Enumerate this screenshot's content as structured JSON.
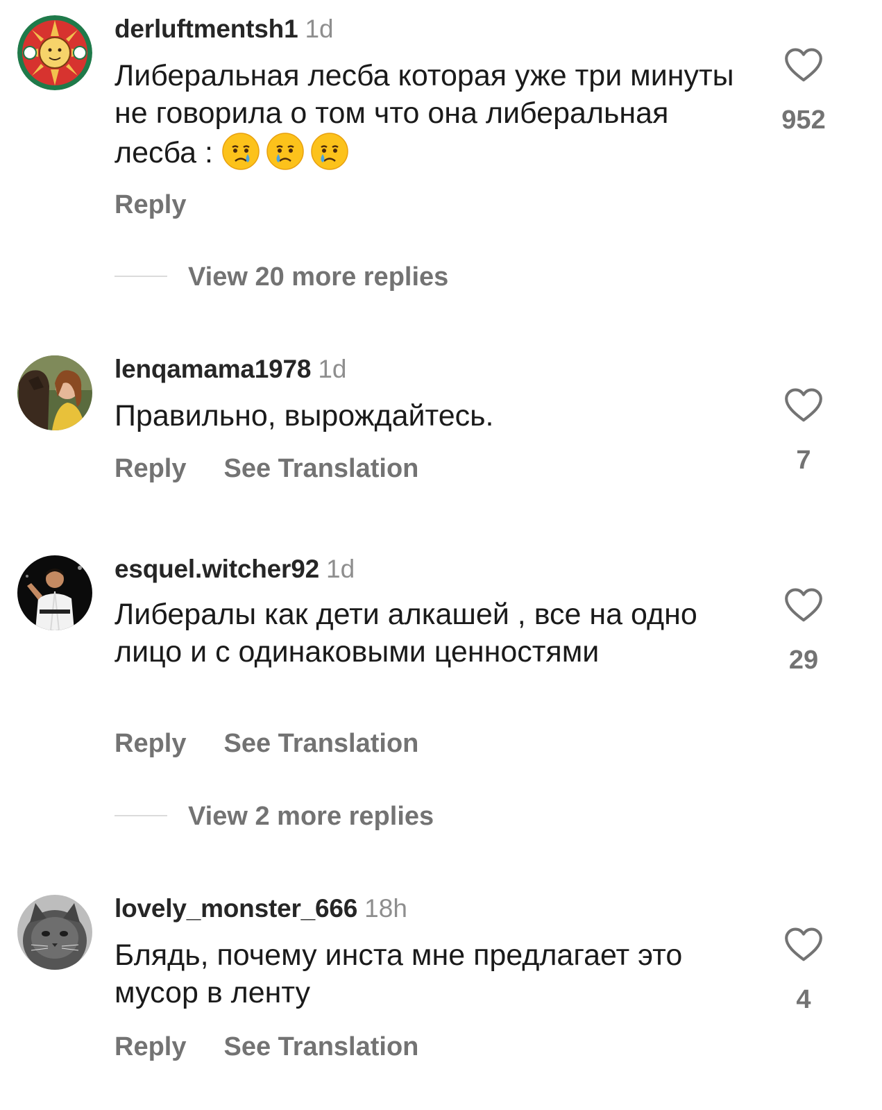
{
  "comments": [
    {
      "username": "derluftmentsh1",
      "time": "1d",
      "text": "Либеральная лесба которая уже три минуты не говорила о том что она либеральная лесба :",
      "emoji_names": [
        "crying-face-icon",
        "crying-face-icon",
        "crying-face-icon"
      ],
      "likes": "952",
      "reply": "Reply",
      "view_more": "View 20 more replies"
    },
    {
      "username": "lenqamama1978",
      "time": "1d",
      "text": "Правильно, вырождайтесь.",
      "likes": "7",
      "reply": "Reply",
      "translate": "See Translation"
    },
    {
      "username": "esquel.witcher92",
      "time": "1d",
      "text": "Либералы как дети алкашей , все на одно лицо и с одинаковыми ценностями",
      "likes": "29",
      "reply": "Reply",
      "translate": "See Translation",
      "view_more": "View 2 more replies"
    },
    {
      "username": "lovely_monster_666",
      "time": "18h",
      "text": "Блядь, почему инста мне предлагает это мусор в ленту",
      "likes": "4",
      "reply": "Reply",
      "translate": "See Translation"
    }
  ],
  "icons": {
    "like": "heart-outline-icon"
  },
  "colors": {
    "secondary_text": "#737373",
    "timestamp": "#8e8e8e",
    "divider": "#dbdbdb"
  }
}
